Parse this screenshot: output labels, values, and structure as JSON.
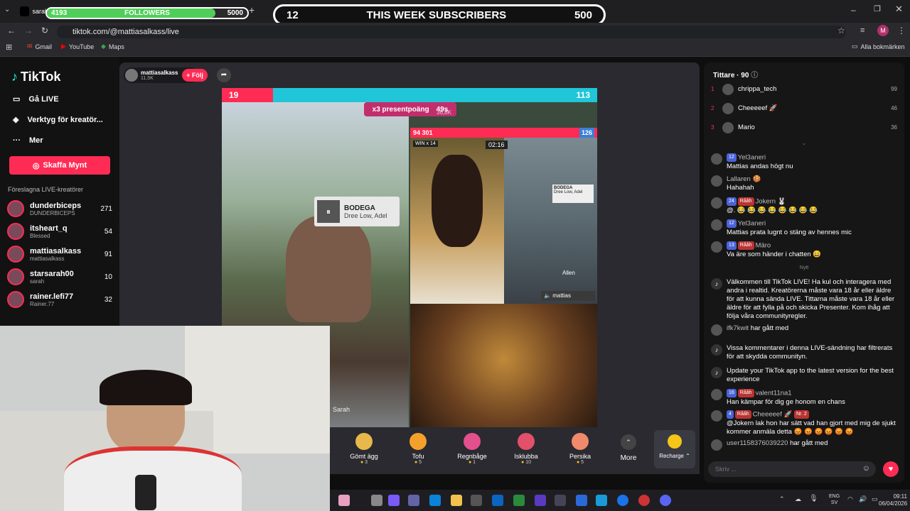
{
  "browser": {
    "tab_label": "sarah",
    "url": "tiktok.com/@mattiasalkass/live",
    "bookmarks": [
      "Gmail",
      "YouTube",
      "Maps"
    ],
    "all_bookmarks": "Alla bokmärken",
    "profile_initial": "M"
  },
  "overlays": {
    "followers": {
      "current": "4193",
      "label": "FOLLOWERS",
      "goal": "5000",
      "progress": 0.84
    },
    "subscribers": {
      "current": "12",
      "label": "THIS WEEK SUBSCRIBERS",
      "goal": "500"
    }
  },
  "sidebar": {
    "logo": "TikTok",
    "nav": [
      {
        "label": "Gå LIVE"
      },
      {
        "label": "Verktyg för kreatör..."
      },
      {
        "label": "Mer"
      }
    ],
    "coins_button": "Skaffa Mynt",
    "suggested_title": "Föreslagna LIVE-kreatörer",
    "suggested": [
      {
        "name": "dunderbiceps",
        "sub": "DUNDERBICEPS",
        "count": "271"
      },
      {
        "name": "itsheart_q",
        "sub": "Blessed",
        "count": "54"
      },
      {
        "name": "mattiasalkass",
        "sub": "mattiasalkass",
        "count": "91"
      },
      {
        "name": "starsarah00",
        "sub": "sarah",
        "count": "10"
      },
      {
        "name": "rainer.lefi77",
        "sub": "Rainer.77",
        "count": "32"
      }
    ]
  },
  "stream": {
    "host": "mattiasalkass",
    "likes": "11,5K",
    "follow": "+ Följ",
    "left_score": "19",
    "right_score": "113",
    "gift_promo": "x3 presentpoäng",
    "timer": "49s",
    "score_label": "36,8K",
    "right_top_score": "94 301",
    "right_badge": "126",
    "win_label": "WIN x 14",
    "countdown": "02:16",
    "song_title": "BODEGA",
    "song_artist": "Dree Low, Adel",
    "small_song_title": "BODEGA",
    "small_song_artist": "Dree Low, Adel",
    "guest_label": "Allen",
    "mute_label": "mattias",
    "bottom_name": "Sarah"
  },
  "gifts": [
    {
      "name": "Gömt ägg",
      "price": "3",
      "color": "#e7b94a"
    },
    {
      "name": "Tofu",
      "price": "5",
      "color": "#f4a12b"
    },
    {
      "name": "Regnbåge",
      "price": "1",
      "color": "#e44f8e"
    },
    {
      "name": "Isklubba",
      "price": "10",
      "color": "#e2506a"
    },
    {
      "name": "Persika",
      "price": "5",
      "color": "#f18a6a"
    }
  ],
  "gift_more": "More",
  "recharge": "Recharge",
  "chat": {
    "viewers_label": "Tittare",
    "viewers_count": "90",
    "top_viewers": [
      {
        "rank": "1",
        "name": "chrippa_tech",
        "score": "99"
      },
      {
        "rank": "2",
        "name": "Cheeeeef 🚀",
        "score": "46"
      },
      {
        "rank": "3",
        "name": "Mario",
        "score": "36"
      }
    ],
    "new_label": "Nytt",
    "messages": [
      {
        "badge": "12",
        "user": "Yel3aneri",
        "text": "Mattias andas högt nu"
      },
      {
        "user": "Lallaren 🍪",
        "text": "Hahahah"
      },
      {
        "badge": "24",
        "badge2": "Rååh",
        "user": "Jokern 🐰",
        "text": "@. 😂 😂 😂 😂 😂 😂 😂 😂"
      },
      {
        "badge": "12",
        "user": "Yel3aneri",
        "text": "Mattias prata lugnt o stäng av hennes mic"
      },
      {
        "badge": "13",
        "badge2": "Rååh",
        "user": "Märo",
        "text": "Va äre som händer i chatten 😄"
      },
      {
        "user": "",
        "text": "Välkommen till TikTok LIVE! Ha kul och interagera med andra i realtid. Kreatörerna måste vara 18 år eller äldre för att kunna sända LIVE. Tittarna måste vara 18 år eller äldre för att fylla på och skicka Presenter. Kom ihåg att följa våra communityregler."
      },
      {
        "user": "ifk7kwit",
        "text": "har gått med"
      },
      {
        "user": "",
        "text": "Vissa kommentarer i denna LIVE-sändning har filtrerats för att skydda communityn."
      },
      {
        "user": "",
        "text": "Update your TikTok app to the latest version for the best experience"
      },
      {
        "badge": "16",
        "badge2": "Rååh",
        "user": "valent11na1",
        "text": "Han kämpar för dig ge honom en chans"
      },
      {
        "badge": "4",
        "badge2": "Rååh",
        "user": "Cheeeeef 🚀",
        "badge3": "Nr. 2",
        "text": "@Jokern lak hon har sätt vad han gjort med mig de sjukt kommer anmäla detta 😡 😡 😡 😡 😡 😡"
      },
      {
        "user": "user1158376039220",
        "text": "har gått med"
      }
    ],
    "input_placeholder": "Skriv ..."
  },
  "taskbar": {
    "lang": "ENG",
    "region": "SV",
    "time": "09:11",
    "date": "06/04/2026"
  }
}
